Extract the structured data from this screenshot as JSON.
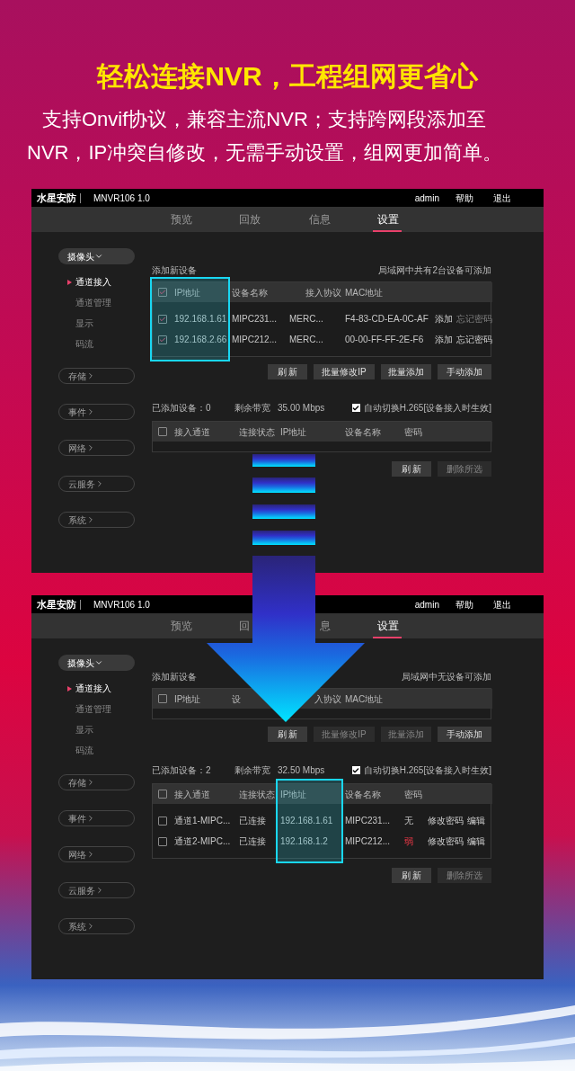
{
  "headline": "轻松连接NVR，工程组网更省心",
  "subtitle_lines": [
    "支持Onvif协议，兼容主流NVR；支持跨网段添加至",
    "NVR，IP冲突自修改，无需手动设置，组网更加简单。"
  ],
  "screens": [
    {
      "brand": "水星安防",
      "model": "MNVR106 1.0",
      "user": "admin",
      "links": [
        "帮助",
        "退出"
      ],
      "tabs": [
        {
          "label": "预览",
          "selected": false
        },
        {
          "label": "回放",
          "selected": false
        },
        {
          "label": "信息",
          "selected": false
        },
        {
          "label": "设置",
          "selected": true
        }
      ],
      "sidebar": [
        {
          "label": "摄像头",
          "expanded": true,
          "children": [
            {
              "label": "通道接入",
              "selected": true
            },
            {
              "label": "通道管理",
              "selected": false
            },
            {
              "label": "显示",
              "selected": false
            },
            {
              "label": "码流",
              "selected": false
            }
          ]
        },
        {
          "label": "存储",
          "expanded": false
        },
        {
          "label": "事件",
          "expanded": false
        },
        {
          "label": "网络",
          "expanded": false
        },
        {
          "label": "云服务",
          "expanded": false
        },
        {
          "label": "系统",
          "expanded": false
        }
      ],
      "add_panel": {
        "title": "添加新设备",
        "note": "局域网中共有2台设备可添加",
        "table": {
          "columns": [
            {
              "kind": "checkbox",
              "checked": true,
              "highlighted": true
            },
            {
              "label": "IP地址",
              "highlighted": true
            },
            {
              "label": "设备名称",
              "highlighted": false
            },
            {
              "label": "接入协议",
              "highlighted": false
            },
            {
              "label": "MAC地址",
              "highlighted": false
            },
            {
              "highlighted": false
            },
            {
              "highlighted": false
            }
          ],
          "rows": [
            {
              "cells": [
                {
                  "kind": "checkbox",
                  "checked": true
                },
                {
                  "kind": "text",
                  "text": "192.168.1.61"
                },
                {
                  "kind": "text",
                  "text": "MIPC231..."
                },
                {
                  "kind": "text",
                  "text": "MERC..."
                },
                {
                  "kind": "text",
                  "text": "F4-83-CD-EA-0C-AF"
                },
                {
                  "kind": "link",
                  "text": "添加",
                  "disabled": false
                },
                {
                  "kind": "link",
                  "text": "忘记密码",
                  "disabled": true
                }
              ]
            },
            {
              "cells": [
                {
                  "kind": "checkbox",
                  "checked": true
                },
                {
                  "kind": "text",
                  "text": "192.168.2.66"
                },
                {
                  "kind": "text",
                  "text": "MIPC212..."
                },
                {
                  "kind": "text",
                  "text": "MERC..."
                },
                {
                  "kind": "text",
                  "text": "00-00-FF-FF-2E-F6"
                },
                {
                  "kind": "link",
                  "text": "添加",
                  "disabled": false
                },
                {
                  "kind": "link",
                  "text": "忘记密码",
                  "disabled": false
                }
              ]
            }
          ]
        },
        "buttons": [
          {
            "label": "刷 新",
            "disabled": false
          },
          {
            "label": "批量修改IP",
            "disabled": false
          },
          {
            "label": "批量添加",
            "disabled": false
          },
          {
            "label": "手动添加",
            "disabled": false
          }
        ]
      },
      "added_panel": {
        "count": "已添加设备：0",
        "bandwidth_label": "剩余带宽",
        "bandwidth": "35.00 Mbps",
        "auto_switch": {
          "checked": true,
          "label": "自动切换H.265[设备接入时生效]"
        },
        "table": {
          "columns": [
            {
              "kind": "checkbox",
              "checked": false,
              "highlighted": false
            },
            {
              "label": "接入通道",
              "highlighted": false
            },
            {
              "label": "连接状态",
              "highlighted": false
            },
            {
              "label": "IP地址",
              "highlighted": false
            },
            {
              "label": "设备名称",
              "highlighted": false
            },
            {
              "label": "密码",
              "highlighted": false
            },
            {
              "highlighted": false
            },
            {
              "highlighted": false
            }
          ]
        },
        "buttons": [
          {
            "label": "刷 新",
            "disabled": false
          },
          {
            "label": "删除所选",
            "disabled": true
          }
        ]
      }
    },
    {
      "brand": "水星安防",
      "model": "MNVR106 1.0",
      "user": "admin",
      "links": [
        "帮助",
        "退出"
      ],
      "tabs": [
        {
          "label": "预览",
          "selected": false
        },
        {
          "label": "回",
          "selected": false
        },
        {
          "label": "息",
          "selected": false
        },
        {
          "label": "设置",
          "selected": true
        }
      ],
      "sidebar": [
        {
          "label": "摄像头",
          "expanded": true,
          "children": [
            {
              "label": "通道接入",
              "selected": true
            },
            {
              "label": "通道管理",
              "selected": false
            },
            {
              "label": "显示",
              "selected": false
            },
            {
              "label": "码流",
              "selected": false
            }
          ]
        },
        {
          "label": "存储",
          "expanded": false
        },
        {
          "label": "事件",
          "expanded": false
        },
        {
          "label": "网络",
          "expanded": false
        },
        {
          "label": "云服务",
          "expanded": false
        },
        {
          "label": "系统",
          "expanded": false
        }
      ],
      "add_panel": {
        "title": "添加新设备",
        "note": "局域网中无设备可添加",
        "table": {
          "columns": [
            {
              "kind": "checkbox",
              "checked": false,
              "highlighted": false
            },
            {
              "label": "IP地址",
              "highlighted": false
            },
            {
              "label": "设",
              "highlighted": false
            },
            {
              "label": "入协议",
              "highlighted": false
            },
            {
              "label": "MAC地址",
              "highlighted": false
            },
            {
              "highlighted": false
            },
            {
              "highlighted": false
            }
          ]
        },
        "buttons": [
          {
            "label": "刷 新",
            "disabled": false
          },
          {
            "label": "批量修改IP",
            "disabled": true
          },
          {
            "label": "批量添加",
            "disabled": true
          },
          {
            "label": "手动添加",
            "disabled": false
          }
        ]
      },
      "added_panel": {
        "count": "已添加设备：2",
        "bandwidth_label": "剩余带宽",
        "bandwidth": "32.50 Mbps",
        "auto_switch": {
          "checked": true,
          "label": "自动切换H.265[设备接入时生效]"
        },
        "table": {
          "columns": [
            {
              "kind": "checkbox",
              "checked": false,
              "highlighted": false
            },
            {
              "label": "接入通道",
              "highlighted": false
            },
            {
              "label": "连接状态",
              "highlighted": false
            },
            {
              "label": "IP地址",
              "highlighted": true
            },
            {
              "label": "设备名称",
              "highlighted": false
            },
            {
              "label": "密码",
              "highlighted": false
            },
            {
              "highlighted": false
            },
            {
              "highlighted": false
            }
          ],
          "rows": [
            {
              "cells": [
                {
                  "kind": "checkbox",
                  "checked": false
                },
                {
                  "kind": "text",
                  "text": "通道1-MIPC..."
                },
                {
                  "kind": "text",
                  "text": "已连接"
                },
                {
                  "kind": "text",
                  "text": "192.168.1.61"
                },
                {
                  "kind": "text",
                  "text": "MIPC231..."
                },
                {
                  "kind": "text",
                  "text": "无"
                },
                {
                  "kind": "link",
                  "text": "修改密码",
                  "disabled": false
                },
                {
                  "kind": "link",
                  "text": "编辑",
                  "disabled": false
                }
              ]
            },
            {
              "cells": [
                {
                  "kind": "checkbox",
                  "checked": false
                },
                {
                  "kind": "text",
                  "text": "通道2-MIPC..."
                },
                {
                  "kind": "text",
                  "text": "已连接"
                },
                {
                  "kind": "text",
                  "text": "192.168.1.2"
                },
                {
                  "kind": "text",
                  "text": "MIPC212..."
                },
                {
                  "kind": "danger",
                  "text": "弱"
                },
                {
                  "kind": "link",
                  "text": "修改密码",
                  "disabled": false
                },
                {
                  "kind": "link",
                  "text": "编辑",
                  "disabled": false
                }
              ]
            }
          ]
        },
        "buttons": [
          {
            "label": "刷 新",
            "disabled": false
          },
          {
            "label": "删除所选",
            "disabled": true
          }
        ]
      }
    }
  ]
}
